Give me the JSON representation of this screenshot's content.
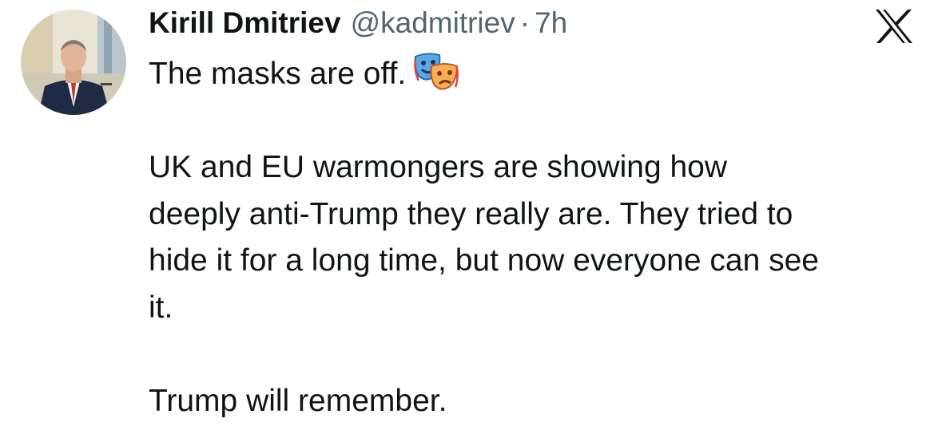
{
  "author": {
    "display_name": "Kirill Dmitriev",
    "handle": "@kadmitriev",
    "separator": "·",
    "time": "7h"
  },
  "platform_logo": "x-logo-icon",
  "tweet": {
    "first_line": "The masks are off.",
    "first_line_emoji": "performing-arts-masks-icon",
    "paragraph_2_lines": [
      "UK and EU warmongers are showing how",
      "deeply anti-Trump they really are. They tried to",
      "hide it for a long time, but now everyone can see",
      "it."
    ],
    "paragraph_3": "Trump will remember."
  },
  "colors": {
    "text": "#0f1419",
    "secondary_text": "#536471",
    "background": "#ffffff"
  }
}
